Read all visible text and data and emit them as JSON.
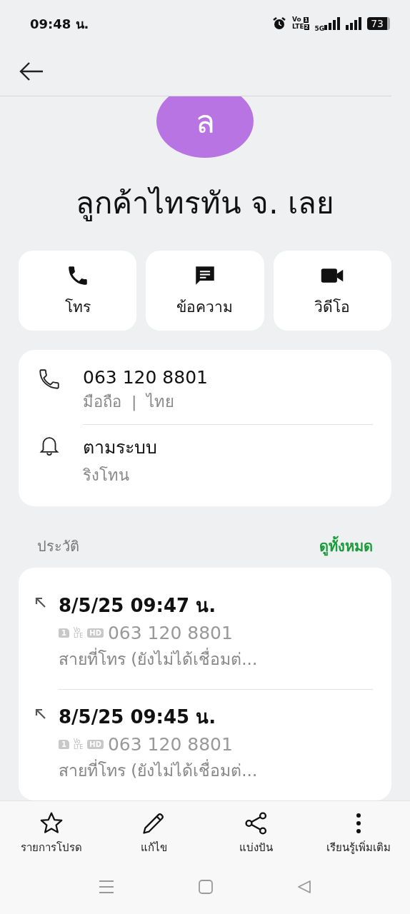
{
  "status_bar": {
    "time": "09:48 น.",
    "volte": [
      "Vo",
      "LTE"
    ],
    "sim_slots": [
      "1",
      "2"
    ],
    "network": "5G",
    "battery": "73"
  },
  "contact": {
    "initial": "ล",
    "name": "ลูกค้าไทรทัน จ. เลย"
  },
  "actions": [
    {
      "kind": "call",
      "label": "โทร"
    },
    {
      "kind": "message",
      "label": "ข้อความ"
    },
    {
      "kind": "video",
      "label": "วิดีโอ"
    }
  ],
  "info": [
    {
      "kind": "phone",
      "title": "063 120 8801",
      "subtitle": "มือถือ  |  ไทย"
    },
    {
      "kind": "ringtone",
      "title": "ตามระบบ",
      "subtitle": "ริงโทน"
    }
  ],
  "history": {
    "title": "ประวัติ",
    "view_all": "ดูทั้งหมด",
    "calls": [
      {
        "kind": "outgoing",
        "time": "8/5/25 09:47 น.",
        "sim": "1",
        "volte": [
          "Vo",
          "LTE"
        ],
        "hd": "HD",
        "number": "063 120 8801",
        "status": "สายที่โทร (ยังไม่ได้เชื่อมต่..."
      },
      {
        "kind": "outgoing",
        "time": "8/5/25 09:45 น.",
        "sim": "1",
        "volte": [
          "Vo",
          "LTE"
        ],
        "hd": "HD",
        "number": "063 120 8801",
        "status": "สายที่โทร (ยังไม่ได้เชื่อมต่..."
      }
    ]
  },
  "bottom_actions": [
    {
      "kind": "star",
      "label": "รายการโปรด"
    },
    {
      "kind": "edit",
      "label": "แก้ไข"
    },
    {
      "kind": "share",
      "label": "แบ่งปัน"
    },
    {
      "kind": "more",
      "label": "เรียนรู้เพิ่มเติม"
    }
  ]
}
